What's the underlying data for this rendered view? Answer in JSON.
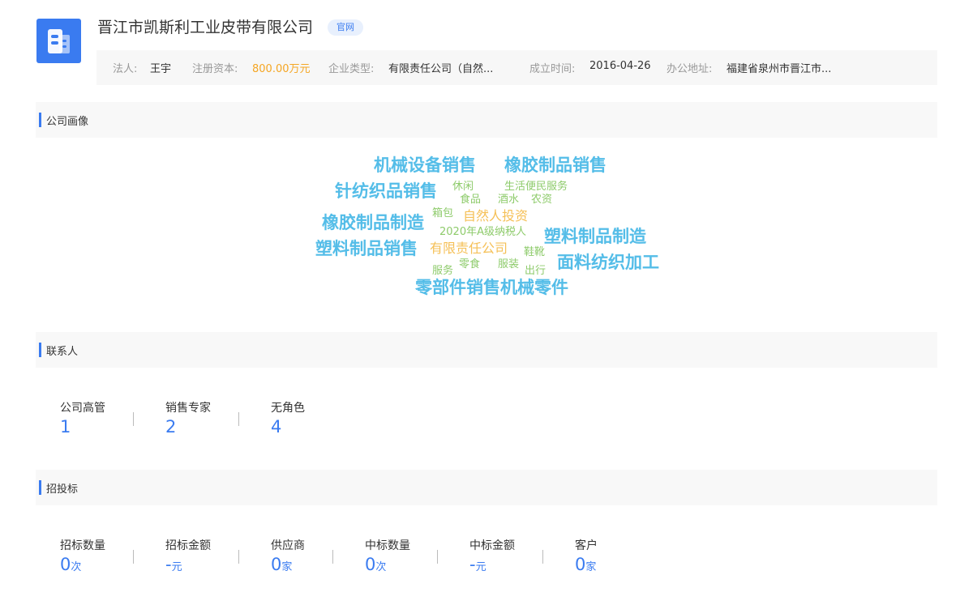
{
  "company": {
    "name": "晋江市凯斯利工业皮带有限公司",
    "official_site_tag": "官网"
  },
  "info": {
    "legal_rep_label": "法人:",
    "legal_rep": "王宇",
    "capital_label": "注册资本:",
    "capital": "800.00万元",
    "type_label": "企业类型:",
    "type": "有限责任公司（自然...",
    "founded_label": "成立时间:",
    "founded": "2016-04-26",
    "address_label": "办公地址:",
    "address": "福建省泉州市晋江市..."
  },
  "sections": {
    "portrait": "公司画像",
    "contacts": "联系人",
    "bidding": "招投标"
  },
  "word_cloud": {
    "words": [
      "机械设备销售",
      "橡胶制品销售",
      "针纺织品销售",
      "休闲",
      "生活便民服务",
      "食品",
      "酒水",
      "农资",
      "箱包",
      "自然人投资",
      "橡胶制品制造",
      "2020年A级纳税人",
      "塑料制品制造",
      "塑料制品销售",
      "有限责任公司",
      "鞋靴",
      "面料纺织加工",
      "服务",
      "零食",
      "服装",
      "出行",
      "零部件销售机械零件"
    ]
  },
  "contacts": {
    "items": [
      {
        "label": "公司高管",
        "value": "1"
      },
      {
        "label": "销售专家",
        "value": "2"
      },
      {
        "label": "无角色",
        "value": "4"
      }
    ]
  },
  "bidding": {
    "items": [
      {
        "label": "招标数量",
        "value": "0",
        "unit": "次"
      },
      {
        "label": "招标金额",
        "value": "-",
        "unit": "元"
      },
      {
        "label": "供应商",
        "value": "0",
        "unit": "家"
      },
      {
        "label": "中标数量",
        "value": "0",
        "unit": "次"
      },
      {
        "label": "中标金额",
        "value": "-",
        "unit": "元"
      },
      {
        "label": "客户",
        "value": "0",
        "unit": "家"
      }
    ]
  },
  "colors": {
    "accent": "#3a7bf0",
    "money": "#f5a623",
    "cloud_large": "#54bde8",
    "cloud_medium": "#f5c057",
    "cloud_small": "#8ecb6b"
  },
  "icons": {
    "logo": "building-icon"
  }
}
